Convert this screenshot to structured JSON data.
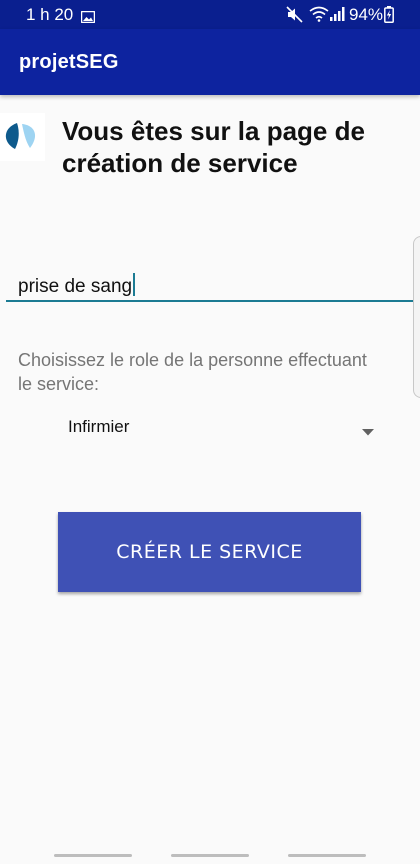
{
  "status_bar": {
    "time": "1 h 20",
    "battery_percent": "94%",
    "icons": [
      "gallery-icon",
      "mute-icon",
      "wifi-icon",
      "signal-icon",
      "battery-charging-icon"
    ]
  },
  "app_bar": {
    "title": "projetSEG"
  },
  "page": {
    "heading": "Vous êtes sur la page de création de service",
    "service_name_value": "prise de sang",
    "role_label": "Choisissez le role de la personne effectuant le service:",
    "role_selected": "Infirmier",
    "create_button_label": "CRÉER LE SERVICE"
  },
  "colors": {
    "app_bar": "#0d239f",
    "status_bar": "#0a1f8f",
    "button": "#3f51b5",
    "input_underline": "#1c7b93",
    "logo_dark": "#0e5a8c",
    "logo_light": "#9ed4f2"
  }
}
